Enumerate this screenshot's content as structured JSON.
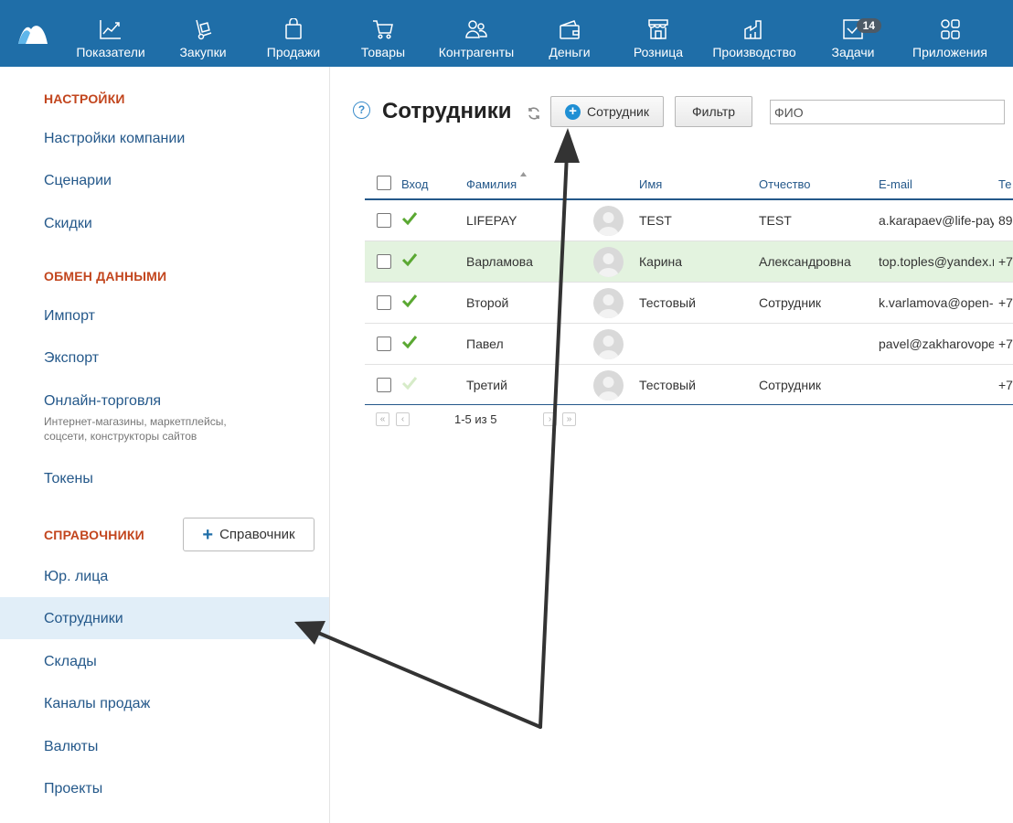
{
  "nav": {
    "items": [
      {
        "label": "Показатели",
        "icon": "chart-line-icon"
      },
      {
        "label": "Закупки",
        "icon": "hand-truck-icon"
      },
      {
        "label": "Продажи",
        "icon": "shopping-bag-icon"
      },
      {
        "label": "Товары",
        "icon": "cart-icon"
      },
      {
        "label": "Контрагенты",
        "icon": "people-icon"
      },
      {
        "label": "Деньги",
        "icon": "wallet-icon"
      },
      {
        "label": "Розница",
        "icon": "store-icon"
      },
      {
        "label": "Производство",
        "icon": "factory-icon"
      },
      {
        "label": "Задачи",
        "icon": "checkbox-icon",
        "badge": "14"
      },
      {
        "label": "Приложения",
        "icon": "apps-icon"
      }
    ],
    "background": "#1f6ea8"
  },
  "sidebar": {
    "settings_title": "НАСТРОЙКИ",
    "settings_items": [
      "Настройки компании",
      "Сценарии",
      "Скидки"
    ],
    "exchange_title": "ОБМЕН ДАННЫМИ",
    "exchange_items": [
      "Импорт",
      "Экспорт",
      "Онлайн-торговля",
      "Токены"
    ],
    "online_trade_sub": "Интернет-магазины, маркетплейсы, соцсети, конструкторы сайтов",
    "refs_title": "СПРАВОЧНИКИ",
    "refs_button": "Справочник",
    "refs_items": [
      "Юр. лица",
      "Сотрудники",
      "Склады",
      "Каналы продаж",
      "Валюты",
      "Проекты"
    ],
    "active_item": "Сотрудники"
  },
  "main": {
    "help": "?",
    "title": "Сотрудники",
    "add_button": "Сотрудник",
    "filter_button": "Фильтр",
    "search_placeholder": "ФИО",
    "columns": [
      "Вход",
      "Фамилия",
      "Имя",
      "Отчество",
      "E-mail",
      "Те"
    ],
    "rows": [
      {
        "login": true,
        "last": "LIFEPAY",
        "first": "TEST",
        "middle": "TEST",
        "email": "a.karapaev@life-pay.",
        "phone": "89"
      },
      {
        "login": true,
        "last": "Варламова",
        "first": "Карина",
        "middle": "Александровна",
        "email": "top.toples@yandex.r",
        "phone": "+7",
        "highlight": true
      },
      {
        "login": true,
        "last": "Второй",
        "first": "Тестовый",
        "middle": "Сотрудник",
        "email": "k.varlamova@open-s",
        "phone": "+7"
      },
      {
        "login": true,
        "last": "Павел",
        "first": "",
        "middle": "",
        "email": "pavel@zakharovoper",
        "phone": "+7"
      },
      {
        "login": false,
        "last": "Третий",
        "first": "Тестовый",
        "middle": "Сотрудник",
        "email": "",
        "phone": "+7"
      }
    ],
    "pager_info": "1-5 из 5"
  },
  "colors": {
    "accent": "#1f6ea8",
    "section": "#c2451d",
    "link": "#24588a",
    "highlight_row": "#e3f3df",
    "active_side": "#e1eef8",
    "check": "#5aa832"
  }
}
